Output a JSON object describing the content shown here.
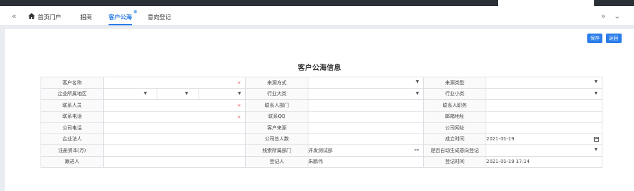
{
  "tabs": {
    "collapse_glyph": "«",
    "items": [
      {
        "label": "首页门户",
        "active": false
      },
      {
        "label": "招商",
        "active": false
      },
      {
        "label": "客户公海",
        "active": true
      },
      {
        "label": "意向登记",
        "active": false
      }
    ],
    "more_glyph": "»",
    "dropdown_glyph": "⌄"
  },
  "toolbar": {
    "save_label": "保存",
    "back_label": "返回"
  },
  "page_title": "客户公海信息",
  "form": {
    "customer_name": {
      "label": "客户名称",
      "value": ""
    },
    "source_method": {
      "label": "来源方式",
      "value": ""
    },
    "source_type": {
      "label": "来源类型",
      "value": ""
    },
    "region": {
      "label": "企业所属地区",
      "value": ""
    },
    "industry_major": {
      "label": "行业大类",
      "value": ""
    },
    "industry_minor": {
      "label": "行业小类",
      "value": ""
    },
    "contact_person": {
      "label": "联系人员",
      "value": ""
    },
    "contact_dept": {
      "label": "联系人部门",
      "value": ""
    },
    "contact_title": {
      "label": "联系人职务",
      "value": ""
    },
    "contact_phone": {
      "label": "联系电话",
      "value": ""
    },
    "contact_qq": {
      "label": "联系QQ",
      "value": ""
    },
    "email": {
      "label": "邮箱地址",
      "value": ""
    },
    "company_phone": {
      "label": "公司电话",
      "value": ""
    },
    "customer_source": {
      "label": "客户来源",
      "value": ""
    },
    "company_website": {
      "label": "公司网址",
      "value": ""
    },
    "legal_person": {
      "label": "企业法人",
      "value": ""
    },
    "headcount": {
      "label": "公司总人数",
      "value": ""
    },
    "founded": {
      "label": "成立时间",
      "value": "2021-01-19"
    },
    "reg_capital": {
      "label": "注册资本(万)",
      "value": ""
    },
    "lead_dept": {
      "label": "线索所属部门",
      "value": "开发测试部"
    },
    "auto_intent": {
      "label": "是否自动生成意向登记",
      "value": ""
    },
    "follower": {
      "label": "跟进人",
      "value": ""
    },
    "registrar": {
      "label": "登记人",
      "value": "朱鹏伟"
    },
    "reg_time": {
      "label": "登记时间",
      "value": "2021-01-19 17:14"
    }
  },
  "colors": {
    "accent": "#2b7de9",
    "required": "#e05757"
  }
}
